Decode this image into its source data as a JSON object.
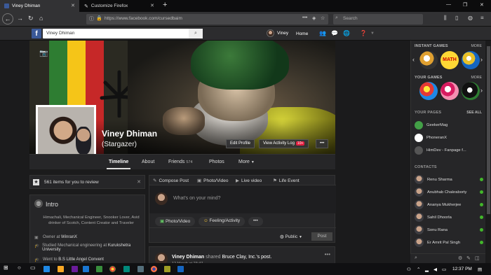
{
  "browser": {
    "tabs": [
      {
        "label": "Viney Dhiman",
        "active": true
      },
      {
        "label": "Customize Firefox",
        "active": false
      }
    ],
    "url": "https://www.facebook.com/cursedbaim",
    "search_placeholder": "Search"
  },
  "fb": {
    "logo": "f",
    "search_value": "Viney Dhiman",
    "user_name": "Viney",
    "home_label": "Home"
  },
  "profile": {
    "name": "Viney Dhiman",
    "nickname": "(Stargazer)",
    "edit_profile": "Edit Profile",
    "activity_log": "View Activity Log",
    "activity_badge": "10+",
    "more_dots": "•••"
  },
  "nav": {
    "tabs": [
      "Timeline",
      "About",
      "Friends",
      "Photos",
      "More"
    ],
    "friends_count": "574"
  },
  "review": {
    "text": "561 items for you to review"
  },
  "intro": {
    "title": "Intro",
    "bio": "Himachali, Mechanical Engineer, Snooker Lover, Avid drinker of Scotch, Content Creator and Traveler",
    "rows": [
      {
        "label": "Owner at ",
        "value": "WinranX"
      },
      {
        "label": "Studied Mechanical engineering at ",
        "value": "Kurukshetra University"
      },
      {
        "label": "Went to ",
        "value": "B.S Little Angel Convent"
      }
    ]
  },
  "composer": {
    "tabs": [
      "Compose Post",
      "Photo/Video",
      "Live video",
      "Life Event"
    ],
    "placeholder": "What's on your mind?",
    "actions": [
      "Photo/Video",
      "Feeling/Activity",
      "•••"
    ],
    "privacy": "Public",
    "post_button": "Post"
  },
  "story": {
    "author": "Viney Dhiman",
    "action": " shared ",
    "target": "Bruce Clay, Inc.'s post.",
    "time": "12 March at 23:47"
  },
  "sidebar": {
    "instant_games": "INSTANT GAMES",
    "your_games": "YOUR GAMES",
    "your_pages": "YOUR PAGES",
    "see_all": "SEE ALL",
    "more": "MORE",
    "contacts": "CONTACTS",
    "game_math_label": "MATH",
    "pages": [
      "GeekerMag",
      "PhoneranX",
      "HimDev - Fanpage f..."
    ],
    "contact_list": [
      "Renu Sharma",
      "Anubhab Chakraborty",
      "Ananya Mukherjee",
      "Sahil Dhoorla",
      "Sonu Rana",
      "Er Amrit Pal Singh"
    ]
  },
  "taskbar": {
    "time": "12:37 PM"
  },
  "colors": {
    "fb_blue": "#3b5998",
    "badge_red": "#e41e3f",
    "online_green": "#42b72a"
  },
  "icons": [
    "camera-icon",
    "search-icon",
    "globe-icon",
    "star-icon",
    "windows-start-icon",
    "firefox-icon"
  ]
}
